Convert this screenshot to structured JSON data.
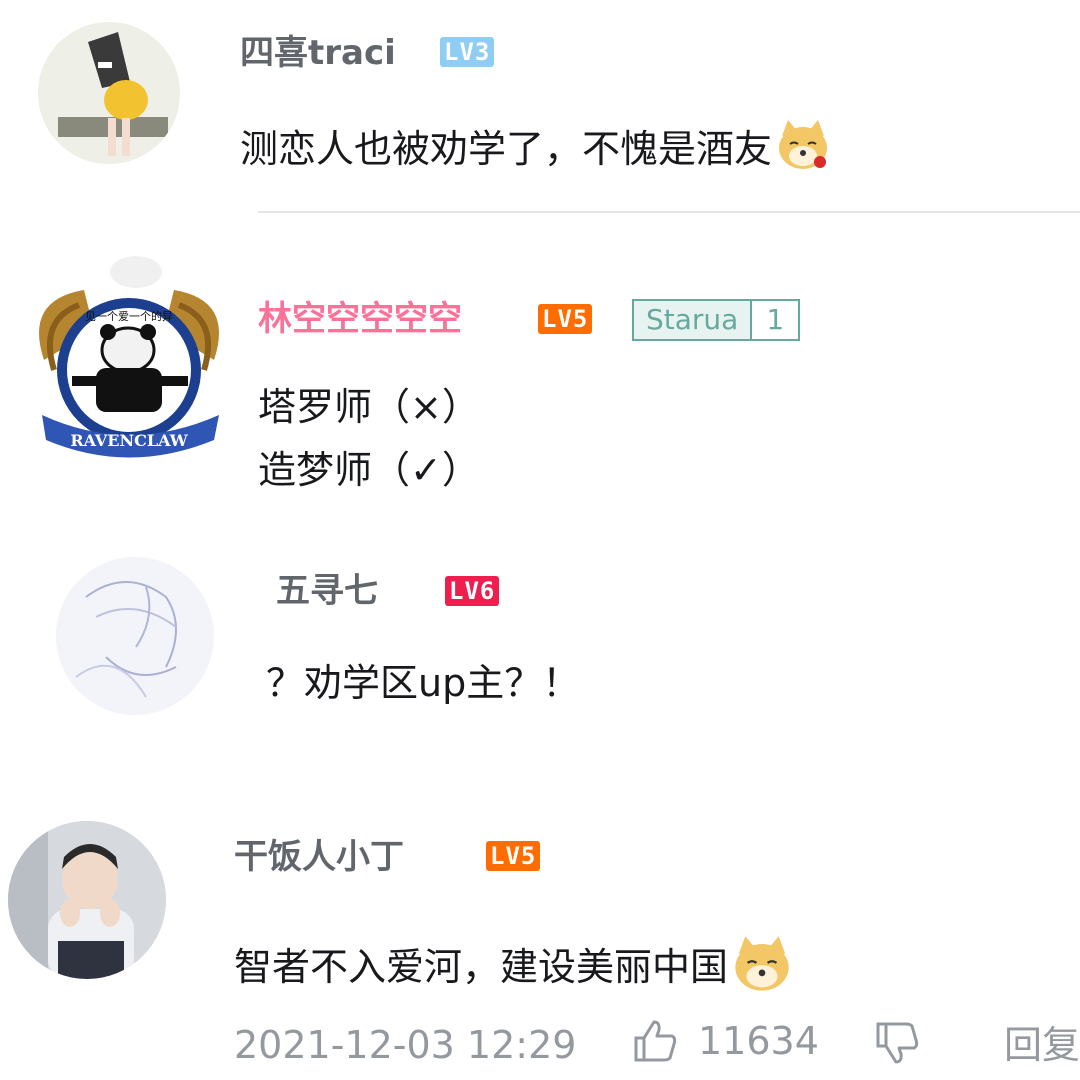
{
  "comments": [
    {
      "username": "四喜traci",
      "level": "LV3",
      "level_color": "#8fcdf4",
      "text": "测恋人也被劝学了，不愧是酒友"
    },
    {
      "username": "林空空空空空",
      "username_color": "#fb7299",
      "level": "LV5",
      "level_color": "#ff6c00",
      "fan_badge_name": "Starua",
      "fan_badge_level": "1",
      "lines": [
        "塔罗师（×）",
        "造梦师（✓）"
      ],
      "avatar_banner_text": "RAVENCLAW",
      "avatar_top_text": "见一个爱一个的异"
    },
    {
      "username": "五寻七",
      "level": "LV6",
      "level_color": "#ee1e4e",
      "text": "？劝学区up主？！"
    },
    {
      "username": "干饭人小丁",
      "level": "LV5",
      "level_color": "#ff6c00",
      "text": "智者不入爱河，建设美丽中国",
      "timestamp": "2021-12-03 12:29",
      "like_count": "11634",
      "reply_label": "回复"
    }
  ],
  "icons": {
    "emoji": "doge-emoji-icon",
    "like": "thumb-up-icon",
    "dislike": "thumb-down-icon"
  }
}
